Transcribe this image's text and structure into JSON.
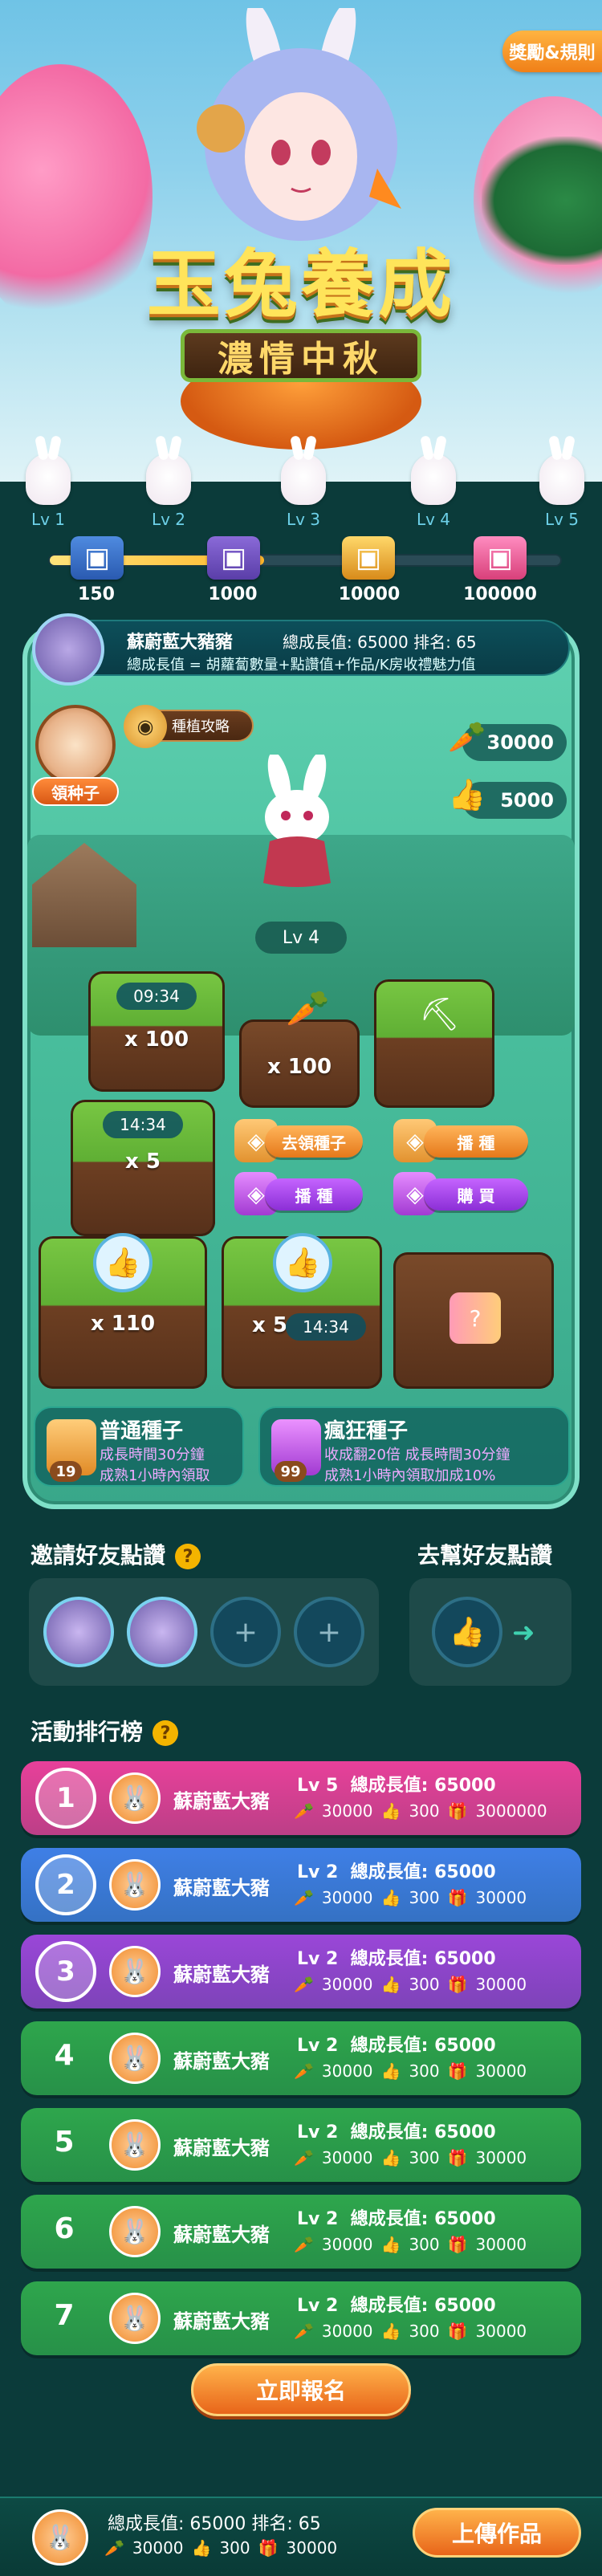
{
  "header": {
    "awards_label": "獎勵&規則",
    "title": "玉兔養成",
    "subtitle": "濃情中秋"
  },
  "levels": [
    {
      "label": "Lv 1"
    },
    {
      "label": "Lv 2"
    },
    {
      "label": "Lv 3"
    },
    {
      "label": "Lv 4"
    },
    {
      "label": "Lv 5"
    }
  ],
  "progress": {
    "fraction": 0.42,
    "milestones": [
      {
        "value": "150",
        "icon": "chest-blue-icon"
      },
      {
        "value": "1000",
        "icon": "chest-purple-icon"
      },
      {
        "value": "10000",
        "icon": "chest-gold-icon"
      },
      {
        "value": "100000",
        "icon": "chest-pink-icon"
      }
    ]
  },
  "user": {
    "name": "蘇蔚藍大豬豬",
    "stats": "總成長值: 65000   排名: 65",
    "desc": "總成長值 = 胡蘿蔔數量+點讚值+作品/K房收禮魅力值"
  },
  "farm": {
    "seed_label": "領种子",
    "guide_label": "種植攻略",
    "carrots": "30000",
    "likes": "5000",
    "level": "Lv 4",
    "plots": {
      "p1_timer": "09:34",
      "p1_mult": "x 100",
      "p2_mult": "x 100",
      "p4_timer": "14:34",
      "p4_mult": "x 5",
      "p7_mult": "x 110",
      "p8_mult": "x 5",
      "p8_timer": "14:34"
    },
    "actions": {
      "get_seed": "去領種子",
      "sow1": "播 種",
      "sow2": "播 種",
      "buy": "購 買"
    }
  },
  "seeds": [
    {
      "title": "普通種子",
      "count": "19",
      "line1": "成長時間30分鐘",
      "line2": "成熟1小時內領取"
    },
    {
      "title": "瘋狂種子",
      "count": "99",
      "line1": "收成翻20倍 成長時間30分鐘",
      "line2": "成熟1小時內領取加成10%"
    }
  ],
  "invite": {
    "title": "邀請好友點讚",
    "help_title": "去幫好友點讚"
  },
  "ranking": {
    "title": "活動排行榜",
    "rows": [
      {
        "rank": "1",
        "name": "蘇蔚藍大豬",
        "level": "Lv 5",
        "growth": "總成長值: 65000",
        "carrot": "30000",
        "like": "300",
        "gift": "3000000",
        "color": "#e8409a"
      },
      {
        "rank": "2",
        "name": "蘇蔚藍大豬",
        "level": "Lv 2",
        "growth": "總成長值: 65000",
        "carrot": "30000",
        "like": "300",
        "gift": "30000",
        "color": "#3f7fe6"
      },
      {
        "rank": "3",
        "name": "蘇蔚藍大豬",
        "level": "Lv 2",
        "growth": "總成長值: 65000",
        "carrot": "30000",
        "like": "300",
        "gift": "30000",
        "color": "#9a46d8"
      },
      {
        "rank": "4",
        "name": "蘇蔚藍大豬",
        "level": "Lv 2",
        "growth": "總成長值: 65000",
        "carrot": "30000",
        "like": "300",
        "gift": "30000",
        "color": "#2ea64c"
      },
      {
        "rank": "5",
        "name": "蘇蔚藍大豬",
        "level": "Lv 2",
        "growth": "總成長值: 65000",
        "carrot": "30000",
        "like": "300",
        "gift": "30000",
        "color": "#2ea64c"
      },
      {
        "rank": "6",
        "name": "蘇蔚藍大豬",
        "level": "Lv 2",
        "growth": "總成長值: 65000",
        "carrot": "30000",
        "like": "300",
        "gift": "30000",
        "color": "#2ea64c"
      },
      {
        "rank": "7",
        "name": "蘇蔚藍大豬",
        "level": "Lv 2",
        "growth": "總成長值: 65000",
        "carrot": "30000",
        "like": "300",
        "gift": "30000",
        "color": "#2ea64c"
      }
    ]
  },
  "signup_label": "立即報名",
  "bottom": {
    "stats": "總成長值: 65000   排名: 65",
    "carrot": "30000",
    "like": "300",
    "gift": "30000",
    "upload_label": "上傳作品"
  }
}
